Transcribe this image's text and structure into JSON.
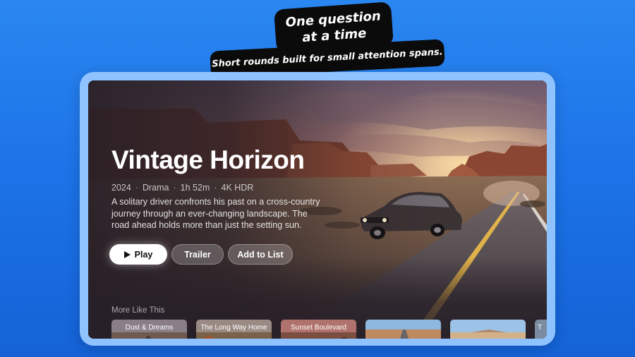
{
  "promo": {
    "headline_line1": "One question",
    "headline_line2": "at a time",
    "subheadline": "Short rounds built for small attention spans."
  },
  "hero": {
    "title": "Vintage Horizon",
    "meta": [
      "2024",
      "Drama",
      "1h 52m",
      "4K HDR"
    ],
    "meta_separator": "·",
    "description": "A solitary driver confronts his past on a cross-country journey through an ever-changing landscape. The road ahead holds more than just the setting sun.",
    "buttons": {
      "play": "Play",
      "trailer": "Trailer",
      "add_to_list": "Add to List"
    }
  },
  "more_like_this": {
    "title": "More Like This",
    "cards": [
      {
        "label": "Dust & Dreams"
      },
      {
        "label": "The Long Way Home"
      },
      {
        "label": "Sunset Boulevard"
      },
      {
        "label": ""
      },
      {
        "label": ""
      },
      {
        "label": "T"
      }
    ]
  },
  "colors": {
    "background": "#1d74e8",
    "frame": "#8fc3ff",
    "sticker": "#0b0b0b",
    "play_button": "#ffffff"
  },
  "icons": {
    "play": "play-icon"
  }
}
